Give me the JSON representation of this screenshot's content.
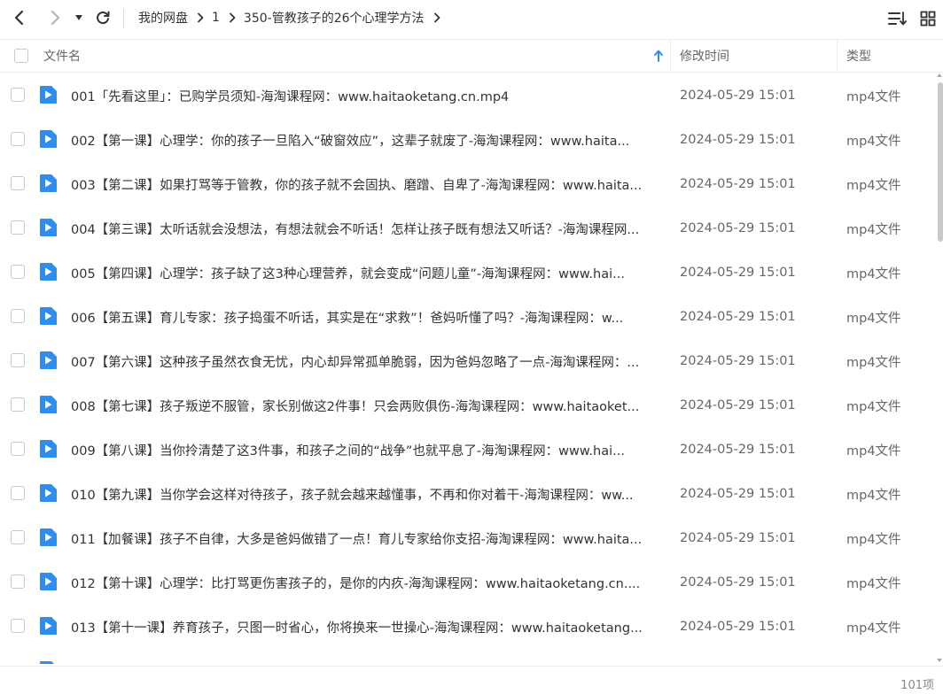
{
  "toolbar": {
    "breadcrumb": [
      "我的网盘",
      "1",
      "350-管教孩子的26个心理学方法"
    ]
  },
  "header": {
    "name": "文件名",
    "modified": "修改时间",
    "type": "类型"
  },
  "colors": {
    "file_icon": "#2f8df0",
    "sort_arrow": "#2f8df0"
  },
  "files": [
    {
      "name": "001「先看这里」：已购学员须知-海淘课程网：www.haitaoketang.cn.mp4",
      "date": "2024-05-29 15:01",
      "type": "mp4文件"
    },
    {
      "name": "002【第一课】心理学：你的孩子一旦陷入“破窗效应”，这辈子就废了-海淘课程网：www.haita...",
      "date": "2024-05-29 15:01",
      "type": "mp4文件"
    },
    {
      "name": "003【第二课】如果打骂等于管教，你的孩子就不会固执、磨蹭、自卑了-海淘课程网：www.haita...",
      "date": "2024-05-29 15:01",
      "type": "mp4文件"
    },
    {
      "name": "004【第三课】太听话就会没想法，有想法就会不听话！怎样让孩子既有想法又听话？-海淘课程网...",
      "date": "2024-05-29 15:01",
      "type": "mp4文件"
    },
    {
      "name": "005【第四课】心理学：孩子缺了这3种心理营养，就会变成“问题儿童”-海淘课程网：www.hai...",
      "date": "2024-05-29 15:01",
      "type": "mp4文件"
    },
    {
      "name": "006【第五课】育儿专家：孩子捣蛋不听话，其实是在“求救”！爸妈听懂了吗？-海淘课程网：w...",
      "date": "2024-05-29 15:01",
      "type": "mp4文件"
    },
    {
      "name": "007【第六课】这种孩子虽然衣食无忧，内心却异常孤单脆弱，因为爸妈忽略了一点-海淘课程网：...",
      "date": "2024-05-29 15:01",
      "type": "mp4文件"
    },
    {
      "name": "008【第七课】孩子叛逆不服管，家长别做这2件事！只会两败俱伤-海淘课程网：www.haitaoket...",
      "date": "2024-05-29 15:01",
      "type": "mp4文件"
    },
    {
      "name": "009【第八课】当你拎清楚了这3件事，和孩子之间的“战争”也就平息了-海淘课程网：www.hai...",
      "date": "2024-05-29 15:01",
      "type": "mp4文件"
    },
    {
      "name": "010【第九课】当你学会这样对待孩子，孩子就会越来越懂事，不再和你对着干-海淘课程网：ww...",
      "date": "2024-05-29 15:01",
      "type": "mp4文件"
    },
    {
      "name": "011【加餐课】孩子不自律，大多是爸妈做错了一点！育儿专家给你支招-海淘课程网：www.haita...",
      "date": "2024-05-29 15:01",
      "type": "mp4文件"
    },
    {
      "name": "012【第十课】心理学：比打骂更伤害孩子的，是你的内疚-海淘课程网：www.haitaoketang.cn....",
      "date": "2024-05-29 15:01",
      "type": "mp4文件"
    },
    {
      "name": "013【第十一课】养育孩子，只图一时省心，你将换来一世操心-海淘课程网：www.haitaoketang...",
      "date": "2024-05-29 15:01",
      "type": "mp4文件"
    }
  ],
  "footer": {
    "count": "101项"
  }
}
